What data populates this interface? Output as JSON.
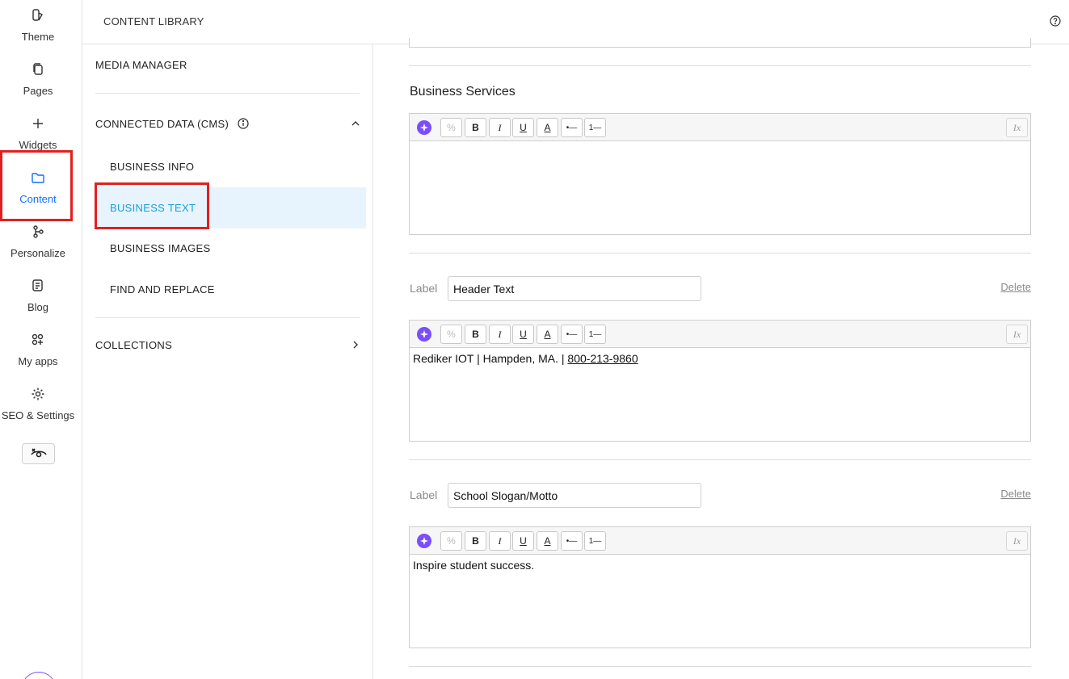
{
  "rail": {
    "items": [
      {
        "label": "Theme",
        "icon": "theme-icon"
      },
      {
        "label": "Pages",
        "icon": "pages-icon"
      },
      {
        "label": "Widgets",
        "icon": "plus-icon"
      },
      {
        "label": "Content",
        "icon": "folder-icon",
        "active": true
      },
      {
        "label": "Personalize",
        "icon": "personalize-icon"
      },
      {
        "label": "Blog",
        "icon": "blog-icon"
      },
      {
        "label": "My apps",
        "icon": "apps-icon"
      },
      {
        "label": "SEO & Settings",
        "icon": "gear-icon"
      }
    ],
    "preview_icon": "eye-preview-icon"
  },
  "header": {
    "title": "CONTENT LIBRARY",
    "help_icon": "help-icon"
  },
  "library": {
    "media_manager": "MEDIA MANAGER",
    "connected_data": "CONNECTED DATA (CMS)",
    "sub_items": [
      "BUSINESS INFO",
      "BUSINESS TEXT",
      "BUSINESS IMAGES",
      "FIND AND REPLACE"
    ],
    "selected": "BUSINESS TEXT",
    "collections": "COLLECTIONS"
  },
  "editor": {
    "section_title": "Business Services",
    "label_word": "Label",
    "delete_label": "Delete",
    "toolbar": {
      "link": "%",
      "bold": "B",
      "italic": "I",
      "underline": "U",
      "color": "A",
      "bullets": "•—",
      "numbers": "1—",
      "clear": "Ix"
    },
    "blocks": [
      {
        "label_value": "",
        "body_text": "",
        "phone": ""
      },
      {
        "label_value": "Header Text",
        "body_text": "Rediker IOT | Hampden, MA. | ",
        "phone": "800-213-9860"
      },
      {
        "label_value": "School Slogan/Motto",
        "body_text": "Inspire student success.",
        "phone": ""
      }
    ]
  },
  "colors": {
    "highlight": "#e02020",
    "selected_bg": "#e7f4fd",
    "selected_text": "#1a9ed8",
    "ai_icon": "#7b4dff"
  }
}
